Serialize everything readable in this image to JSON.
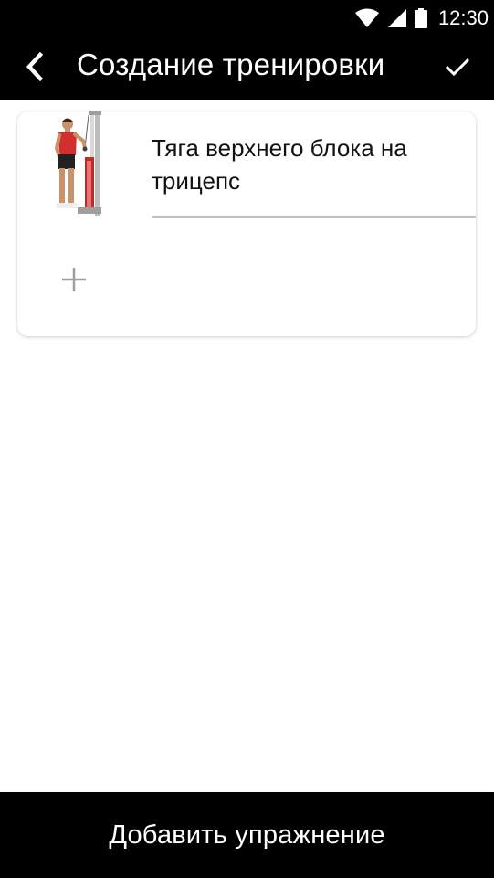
{
  "status_bar": {
    "time": "12:30",
    "icons": [
      "wifi-icon",
      "cellular-signal-icon",
      "battery-icon"
    ]
  },
  "app_bar": {
    "title": "Создание тренировки",
    "back_icon": "chevron-left-icon",
    "confirm_icon": "check-icon"
  },
  "workout": {
    "exercises": [
      {
        "name": "Тяга верхнего блока на трицепс",
        "image": "triceps-pushdown-illustration"
      }
    ],
    "add_icon": "plus-icon"
  },
  "bottom_button": {
    "label": "Добавить упражнение"
  },
  "colors": {
    "bar_background": "#000000",
    "bar_text": "#ffffff",
    "page_background": "#ffffff",
    "underline": "#bdbdbd",
    "plus_icon": "#9e9e9e",
    "athlete_shirt": "#d32f2f",
    "machine_red": "#c62828"
  }
}
